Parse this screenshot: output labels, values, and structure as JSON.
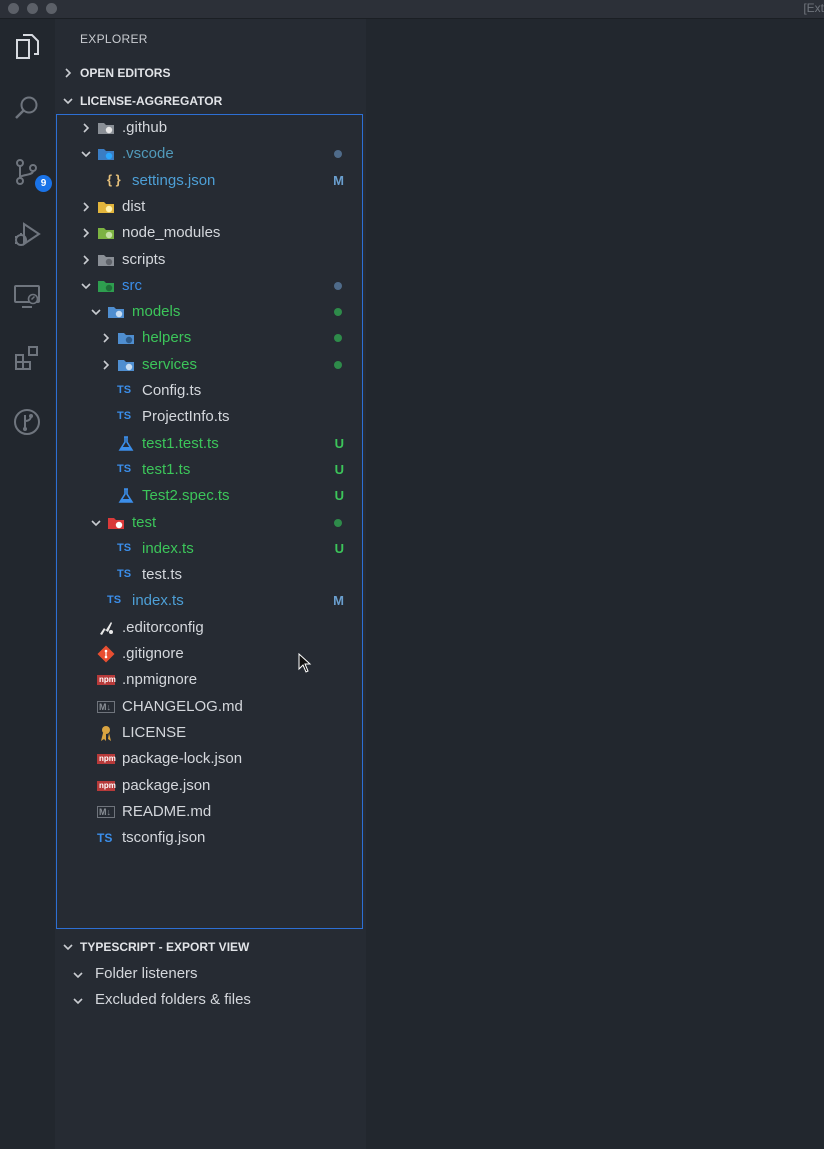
{
  "window": {
    "title_fragment": "[Ext"
  },
  "activity_bar": {
    "items": [
      {
        "name": "explorer-icon",
        "active": true
      },
      {
        "name": "search-icon",
        "active": false
      },
      {
        "name": "source-control-icon",
        "active": false,
        "badge": "9"
      },
      {
        "name": "run-debug-icon",
        "active": false
      },
      {
        "name": "remote-explorer-icon",
        "active": false
      },
      {
        "name": "extensions-icon",
        "active": false
      },
      {
        "name": "git-graph-icon",
        "active": false
      }
    ]
  },
  "sidebar": {
    "title": "EXPLORER",
    "open_editors": {
      "label": "OPEN EDITORS",
      "expanded": false
    },
    "workspace": {
      "label": "LICENSE-AGGREGATOR",
      "expanded": true
    }
  },
  "tree": [
    {
      "name": ".github",
      "depth": 0,
      "kind": "folder",
      "expanded": false,
      "icon": "github-folder-icon",
      "color": "#d4d7dc"
    },
    {
      "name": ".vscode",
      "depth": 0,
      "kind": "folder",
      "expanded": true,
      "icon": "vscode-folder-icon",
      "color": "#519aba",
      "dot": "#4f6b8a"
    },
    {
      "name": "settings.json",
      "depth": 1,
      "kind": "file",
      "icon": "json-icon",
      "color": "#4d9fd6",
      "status": "M",
      "status_color": "#6a9fcf"
    },
    {
      "name": "dist",
      "depth": 0,
      "kind": "folder",
      "expanded": false,
      "icon": "dist-folder-icon",
      "color": "#d4d7dc"
    },
    {
      "name": "node_modules",
      "depth": 0,
      "kind": "folder",
      "expanded": false,
      "icon": "node-folder-icon",
      "color": "#d4d7dc"
    },
    {
      "name": "scripts",
      "depth": 0,
      "kind": "folder",
      "expanded": false,
      "icon": "scripts-folder-icon",
      "color": "#d4d7dc"
    },
    {
      "name": "src",
      "depth": 0,
      "kind": "folder",
      "expanded": true,
      "icon": "src-folder-icon",
      "color": "#3b8eea",
      "dot": "#4f6b8a"
    },
    {
      "name": "models",
      "depth": 1,
      "kind": "folder",
      "expanded": true,
      "icon": "models-folder-icon",
      "color": "#3cc55a",
      "dot": "#2e8b4a"
    },
    {
      "name": "helpers",
      "depth": 2,
      "kind": "folder",
      "expanded": false,
      "icon": "helpers-folder-icon",
      "color": "#3cc55a",
      "dot": "#2e8b4a"
    },
    {
      "name": "services",
      "depth": 2,
      "kind": "folder",
      "expanded": false,
      "icon": "services-folder-icon",
      "color": "#3cc55a",
      "dot": "#2e8b4a"
    },
    {
      "name": "Config.ts",
      "depth": 2,
      "kind": "file",
      "icon": "typescript-icon",
      "color": "#d4d7dc"
    },
    {
      "name": "ProjectInfo.ts",
      "depth": 2,
      "kind": "file",
      "icon": "typescript-icon",
      "color": "#d4d7dc"
    },
    {
      "name": "test1.test.ts",
      "depth": 2,
      "kind": "file",
      "icon": "test-flask-icon",
      "color": "#3cc55a",
      "status": "U",
      "status_color": "#3cc55a"
    },
    {
      "name": "test1.ts",
      "depth": 2,
      "kind": "file",
      "icon": "typescript-icon",
      "color": "#3cc55a",
      "status": "U",
      "status_color": "#3cc55a"
    },
    {
      "name": "Test2.spec.ts",
      "depth": 2,
      "kind": "file",
      "icon": "test-flask-icon",
      "color": "#3cc55a",
      "status": "U",
      "status_color": "#3cc55a"
    },
    {
      "name": "test",
      "depth": 1,
      "kind": "folder",
      "expanded": true,
      "icon": "test-folder-icon",
      "color": "#3cc55a",
      "dot": "#2e8b4a"
    },
    {
      "name": "index.ts",
      "depth": 2,
      "kind": "file",
      "icon": "typescript-icon",
      "color": "#3cc55a",
      "status": "U",
      "status_color": "#3cc55a"
    },
    {
      "name": "test.ts",
      "depth": 2,
      "kind": "file",
      "icon": "typescript-icon",
      "color": "#d4d7dc"
    },
    {
      "name": "index.ts",
      "depth": 1,
      "kind": "file",
      "icon": "typescript-icon",
      "color": "#4d9fd6",
      "status": "M",
      "status_color": "#6a9fcf"
    },
    {
      "name": ".editorconfig",
      "depth": 0,
      "kind": "file",
      "icon": "editorconfig-icon",
      "color": "#d4d7dc"
    },
    {
      "name": ".gitignore",
      "depth": 0,
      "kind": "file",
      "icon": "git-icon",
      "color": "#d4d7dc"
    },
    {
      "name": ".npmignore",
      "depth": 0,
      "kind": "file",
      "icon": "npm-icon",
      "color": "#d4d7dc"
    },
    {
      "name": "CHANGELOG.md",
      "depth": 0,
      "kind": "file",
      "icon": "markdown-icon",
      "color": "#d4d7dc"
    },
    {
      "name": "LICENSE",
      "depth": 0,
      "kind": "file",
      "icon": "license-icon",
      "color": "#d4d7dc"
    },
    {
      "name": "package-lock.json",
      "depth": 0,
      "kind": "file",
      "icon": "npm-icon",
      "color": "#d4d7dc"
    },
    {
      "name": "package.json",
      "depth": 0,
      "kind": "file",
      "icon": "npm-icon",
      "color": "#d4d7dc"
    },
    {
      "name": "README.md",
      "depth": 0,
      "kind": "file",
      "icon": "markdown-icon",
      "color": "#d4d7dc"
    },
    {
      "name": "tsconfig.json",
      "depth": 0,
      "kind": "file",
      "icon": "tsconfig-icon",
      "color": "#d4d7dc"
    }
  ],
  "export_view": {
    "label": "TYPESCRIPT - EXPORT VIEW",
    "expanded": true,
    "items": [
      {
        "label": "Folder listeners",
        "expanded": true
      },
      {
        "label": "Excluded folders & files",
        "expanded": true
      }
    ]
  },
  "icon_labels": {
    "typescript": "TS",
    "json": "{ }",
    "markdown": "M↓",
    "npm": "npm"
  }
}
